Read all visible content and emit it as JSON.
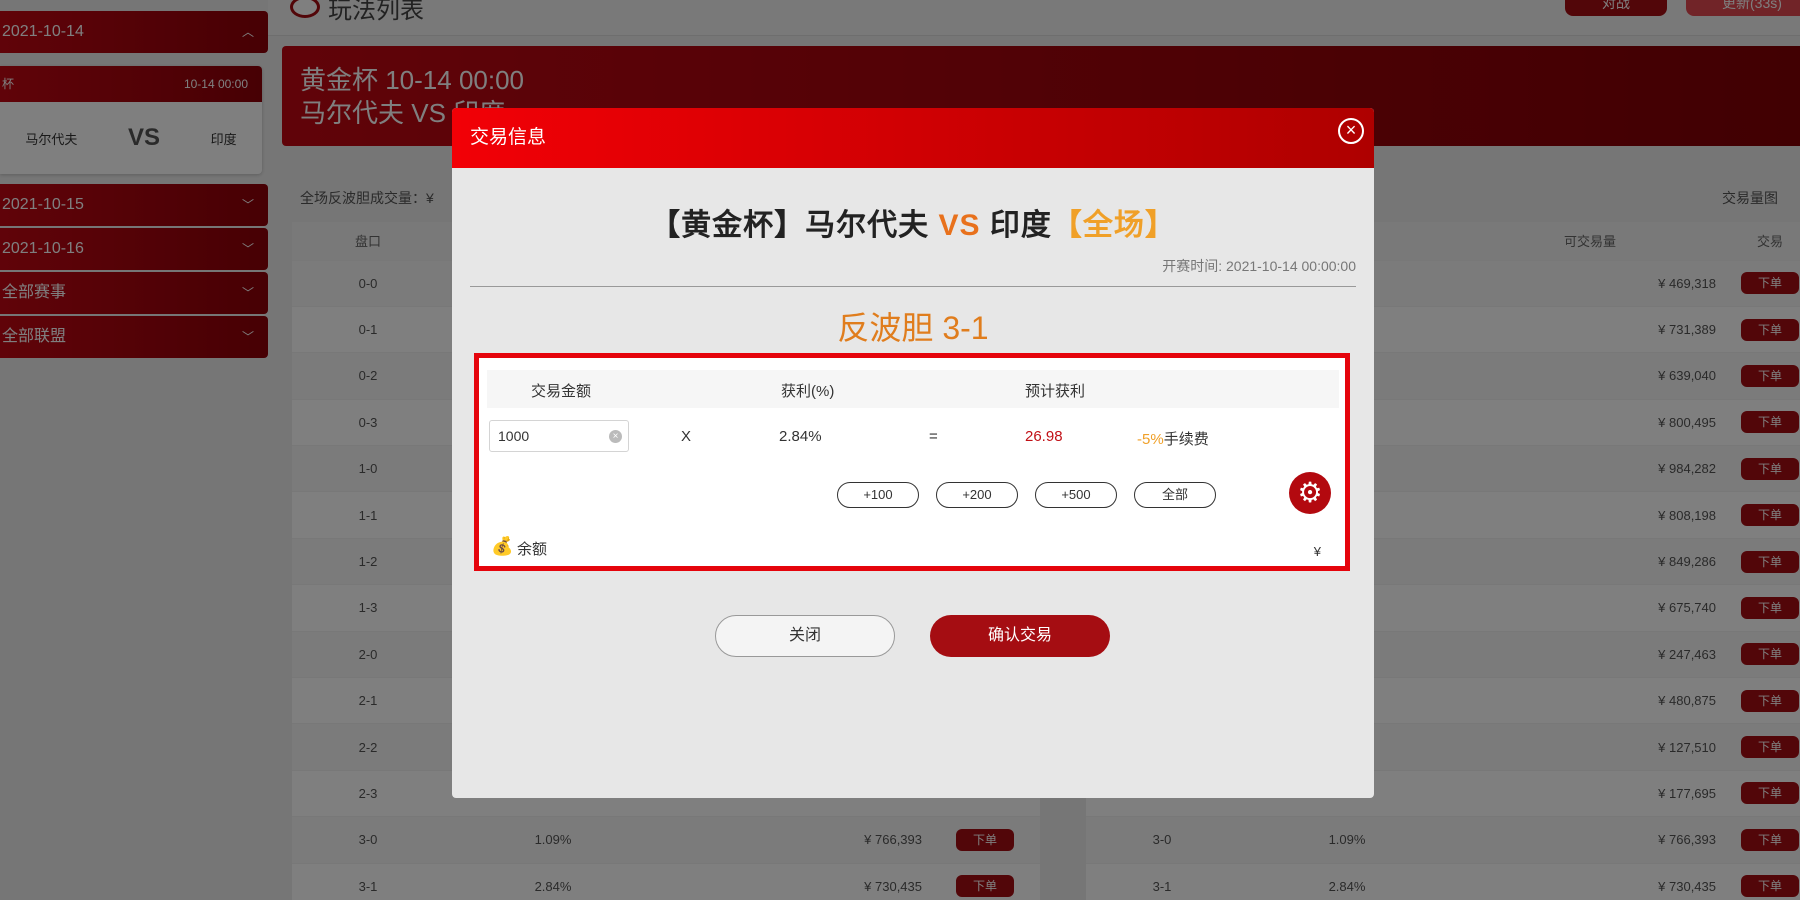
{
  "topbar": {
    "title": "玩法列表",
    "btn_left": "对战",
    "btn_right": "更新(33s)"
  },
  "sidebar": {
    "dates": [
      {
        "label": "2021-10-14",
        "chevron": "︿"
      },
      {
        "label": "2021-10-15",
        "chevron": "﹀"
      },
      {
        "label": "2021-10-16",
        "chevron": "﹀"
      },
      {
        "label": "全部赛事",
        "chevron": "﹀"
      },
      {
        "label": "全部联盟",
        "chevron": "﹀"
      }
    ],
    "match_card": {
      "league": "杯",
      "time": "10-14 00:00",
      "home": "马尔代夫",
      "vs": "VS",
      "away": "印度"
    }
  },
  "banner": {
    "line1": "黄金杯 10-14 00:00",
    "line2": "马尔代夫 VS 印度"
  },
  "summary": {
    "label": "全场反波胆成交量：¥",
    "volume_label": "交易量图"
  },
  "table": {
    "left_headers": {
      "col1": "盘口"
    },
    "right_headers": {
      "col_avail": "可交易量",
      "col_trade": "交易"
    },
    "order_label": "下单",
    "rows": [
      {
        "score": "0-0",
        "pct": "",
        "left_amt": "",
        "right_amt": "¥ 469,318"
      },
      {
        "score": "0-1",
        "pct": "",
        "left_amt": "",
        "right_amt": "¥ 731,389"
      },
      {
        "score": "0-2",
        "pct": "",
        "left_amt": "",
        "right_amt": "¥ 639,040"
      },
      {
        "score": "0-3",
        "pct": "",
        "left_amt": "",
        "right_amt": "¥ 800,495"
      },
      {
        "score": "1-0",
        "pct": "",
        "left_amt": "",
        "right_amt": "¥ 984,282"
      },
      {
        "score": "1-1",
        "pct": "",
        "left_amt": "",
        "right_amt": "¥ 808,198"
      },
      {
        "score": "1-2",
        "pct": "",
        "left_amt": "",
        "right_amt": "¥ 849,286"
      },
      {
        "score": "1-3",
        "pct": "",
        "left_amt": "",
        "right_amt": "¥ 675,740"
      },
      {
        "score": "2-0",
        "pct": "",
        "left_amt": "",
        "right_amt": "¥ 247,463"
      },
      {
        "score": "2-1",
        "pct": "",
        "left_amt": "",
        "right_amt": "¥ 480,875"
      },
      {
        "score": "2-2",
        "pct": "",
        "left_amt": "",
        "right_amt": "¥ 127,510"
      },
      {
        "score": "2-3",
        "pct": "",
        "left_amt": "",
        "right_amt": "¥ 177,695"
      },
      {
        "score": "3-0",
        "pct": "1.09%",
        "left_amt": "¥ 766,393",
        "right_amt": "¥ 766,393"
      },
      {
        "score": "3-1",
        "pct": "2.84%",
        "left_amt": "¥ 730,435",
        "right_amt": "¥ 730,435"
      }
    ]
  },
  "modal": {
    "header": "交易信息",
    "close_icon": "⊗",
    "match": {
      "prefix": "【黄金杯】马尔代夫 ",
      "vs": "VS",
      "away": " 印度",
      "scope": "【全场】"
    },
    "start_time": "开赛时间: 2021-10-14 00:00:00",
    "bet_name": "反波胆 3-1",
    "calc": {
      "head_amount": "交易金额",
      "head_profit": "获利(%)",
      "head_expected": "预计获利",
      "amount_value": "1000",
      "times": "X",
      "rate": "2.84%",
      "equals": "=",
      "expected_value": "26.98",
      "fee_pct": "-5%",
      "fee_label": "手续费",
      "quick": [
        "+100",
        "+200",
        "+500",
        "全部"
      ],
      "balance_label": "余额",
      "balance_value": "¥"
    },
    "buttons": {
      "close": "关闭",
      "confirm": "确认交易"
    }
  },
  "colors": {
    "primary_red": "#a50d12",
    "accent_orange": "#e8711c",
    "gold": "#f0a028",
    "modal_head_red": "#f20006"
  }
}
